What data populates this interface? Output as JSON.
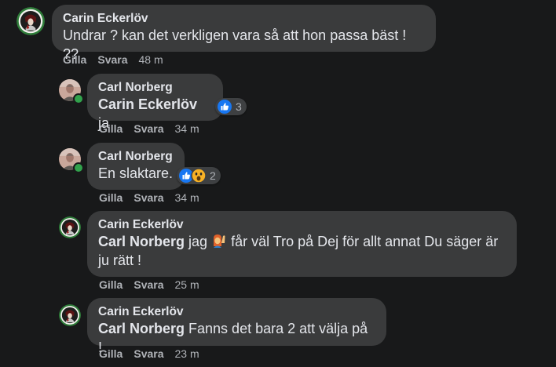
{
  "comments": [
    {
      "author": "Carin Eckerlöv",
      "text": "Undrar ? kan det verkligen vara så att hon passa bäst ! ??",
      "like": "Gilla",
      "reply": "Svara",
      "time": "48 m"
    },
    {
      "author": "Carl Norberg",
      "mention": "Carin Eckerlöv",
      "text": " ja",
      "reaction_count": "3",
      "reactions": [
        "like-icon"
      ],
      "like": "Gilla",
      "reply": "Svara",
      "time": "34 m"
    },
    {
      "author": "Carl Norberg",
      "text": "En slaktare.",
      "reaction_count": "2",
      "reactions": [
        "like-icon",
        "wow-icon"
      ],
      "like": "Gilla",
      "reply": "Svara",
      "time": "34 m"
    },
    {
      "author": "Carin Eckerlöv",
      "mention": "Carl Norberg",
      "text_before_emoji": " jag",
      "emoji": "raising-hand-emoji",
      "text_after_emoji": " får väl Tro på Dej för allt annat Du säger är ju rätt !",
      "like": "Gilla",
      "reply": "Svara",
      "time": "25 m"
    },
    {
      "author": "Carin Eckerlöv",
      "mention": "Carl Norberg",
      "text": " Fanns det bara 2 att välja på !",
      "like": "Gilla",
      "reply": "Svara",
      "time": "23 m"
    }
  ],
  "colors": {
    "background": "#18191a",
    "bubble": "#3a3b3c",
    "text": "#e4e6eb",
    "secondary_text": "#b0b3b8",
    "online": "#31a24c",
    "like_blue": "#1877f2",
    "wow_yellow": "#f7b125"
  }
}
